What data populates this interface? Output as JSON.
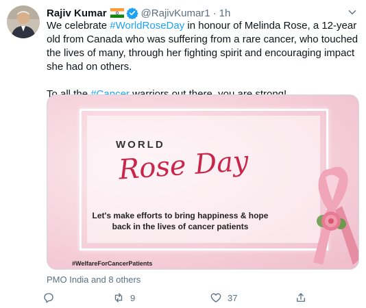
{
  "tweet": {
    "display_name": "Rajiv Kumar",
    "handle": "@RajivKumar1",
    "separator": "·",
    "time": "1h",
    "text_before_tag1": "We celebrate ",
    "hashtag1": "#WorldRoseDay",
    "text_after_tag1": " in honour of Melinda Rose, a 12-year old from Canada who was suffering from a rare cancer, who touched the lives of many, through her fighting spirit and encouraging impact she had on others.",
    "text2_before_tag": "To all the ",
    "hashtag2": "#Cancer",
    "text2_after_tag": " warriors out there, you are strong!",
    "tagged_users": "PMO India and 8 others"
  },
  "image": {
    "world": "WORLD",
    "rose_day": "Rose Day",
    "tagline": "Let's make efforts to bring happiness & hope back in the lives of cancer patients",
    "hashtag": "#WelfareForCancerPatients"
  },
  "actions": {
    "reply_count": "",
    "retweet_count": "9",
    "like_count": "37"
  },
  "icons": {
    "flag": "india-flag-icon",
    "verified": "verified-badge-icon",
    "more": "more-options-icon",
    "reply": "reply-icon",
    "retweet": "retweet-icon",
    "like": "heart-icon",
    "share": "share-icon",
    "person": "person-icon"
  },
  "colors": {
    "accent": "#1da1f2",
    "muted": "#5b7083",
    "rose_red": "#c8264a"
  }
}
